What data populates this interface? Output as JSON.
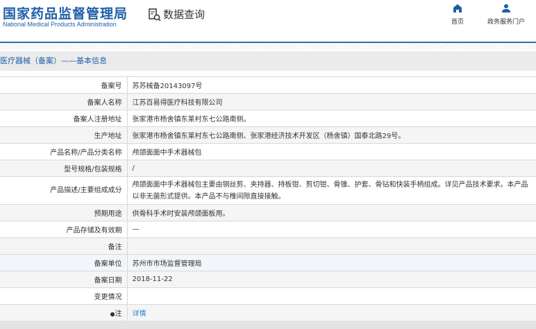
{
  "header": {
    "logo_cn": "国家药品监督管理局",
    "logo_en": "National Medical Products Administration",
    "query_label": "数据查询",
    "nav": [
      {
        "label": "首页",
        "icon": "home-icon"
      },
      {
        "label": "政务服务门户",
        "icon": "user-icon"
      }
    ]
  },
  "breadcrumb": "医疗器械（备案）——基本信息",
  "rows": [
    {
      "label": "备案号",
      "value": "苏苏械备20143097号"
    },
    {
      "label": "备案人名称",
      "value": "江苏百易得医疗科技有限公司"
    },
    {
      "label": "备案人注册地址",
      "value": "张家港市杨舍镇东莱村东七公路南侧。"
    },
    {
      "label": "生产地址",
      "value": "张家港市杨舍镇东莱村东七公路南侧、张家港经济技术开发区（杨舍镇）国泰北路29号。"
    },
    {
      "label": "产品名称/产品分类名称",
      "value": "颅颌面面中手术器械包"
    },
    {
      "label": "型号规格/包装规格",
      "value": "/"
    },
    {
      "label": "产品描述/主要组成成分",
      "value": "颅颌面面中手术器械包主要由钢丝剪、夹持器、持板钳、剪切钳、骨锥、护套、骨钻和快装手柄组成。详见产品技术要求。本产品以非无菌形式提供。本产品不与椎间隙直接接触。"
    },
    {
      "label": "预期用途",
      "value": "供骨科手术时安装颅颌面板用。"
    },
    {
      "label": "产品存储及有效期",
      "value": "—"
    },
    {
      "label": "备注",
      "value": ""
    },
    {
      "label": "备案单位",
      "value": "苏州市市场监督管理局"
    },
    {
      "label": "备案日期",
      "value": "2018-11-22"
    },
    {
      "label": "变更情况",
      "value": ""
    },
    {
      "label": "注",
      "value": "详情"
    }
  ]
}
